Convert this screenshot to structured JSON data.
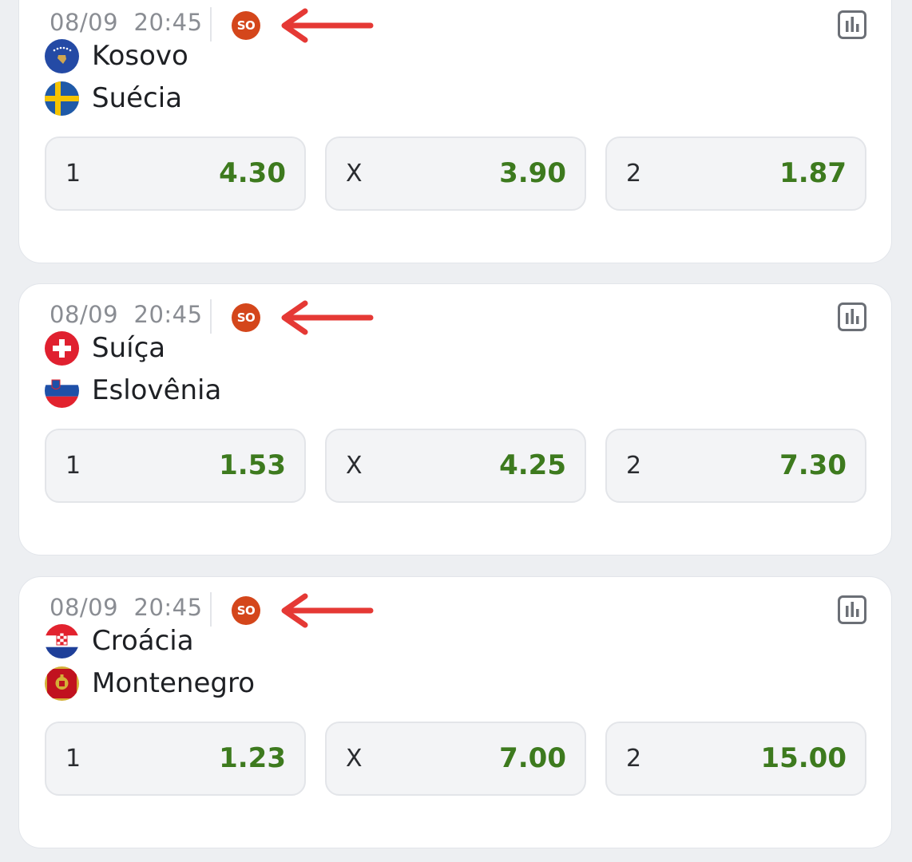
{
  "matches": [
    {
      "datetime": "08/09  20:45",
      "badge": "SO",
      "home": {
        "name": "Kosovo",
        "flag": "kosovo-flag"
      },
      "away": {
        "name": "Suécia",
        "flag": "sweden-flag"
      },
      "odds": [
        {
          "label": "1",
          "value": "4.30"
        },
        {
          "label": "X",
          "value": "3.90"
        },
        {
          "label": "2",
          "value": "1.87"
        }
      ]
    },
    {
      "datetime": "08/09  20:45",
      "badge": "SO",
      "home": {
        "name": "Suíça",
        "flag": "switzerland-flag"
      },
      "away": {
        "name": "Eslovênia",
        "flag": "slovenia-flag"
      },
      "odds": [
        {
          "label": "1",
          "value": "1.53"
        },
        {
          "label": "X",
          "value": "4.25"
        },
        {
          "label": "2",
          "value": "7.30"
        }
      ]
    },
    {
      "datetime": "08/09  20:45",
      "badge": "SO",
      "home": {
        "name": "Croácia",
        "flag": "croatia-flag"
      },
      "away": {
        "name": "Montenegro",
        "flag": "montenegro-flag"
      },
      "odds": [
        {
          "label": "1",
          "value": "1.23"
        },
        {
          "label": "X",
          "value": "7.00"
        },
        {
          "label": "2",
          "value": "15.00"
        }
      ]
    }
  ],
  "colors": {
    "odd_value": "#3d7a1e",
    "badge": "#d4461b",
    "annotation_arrow": "#e53935"
  },
  "icons": {
    "stats": "bar-chart-icon",
    "annotation": "left-arrow-icon"
  }
}
